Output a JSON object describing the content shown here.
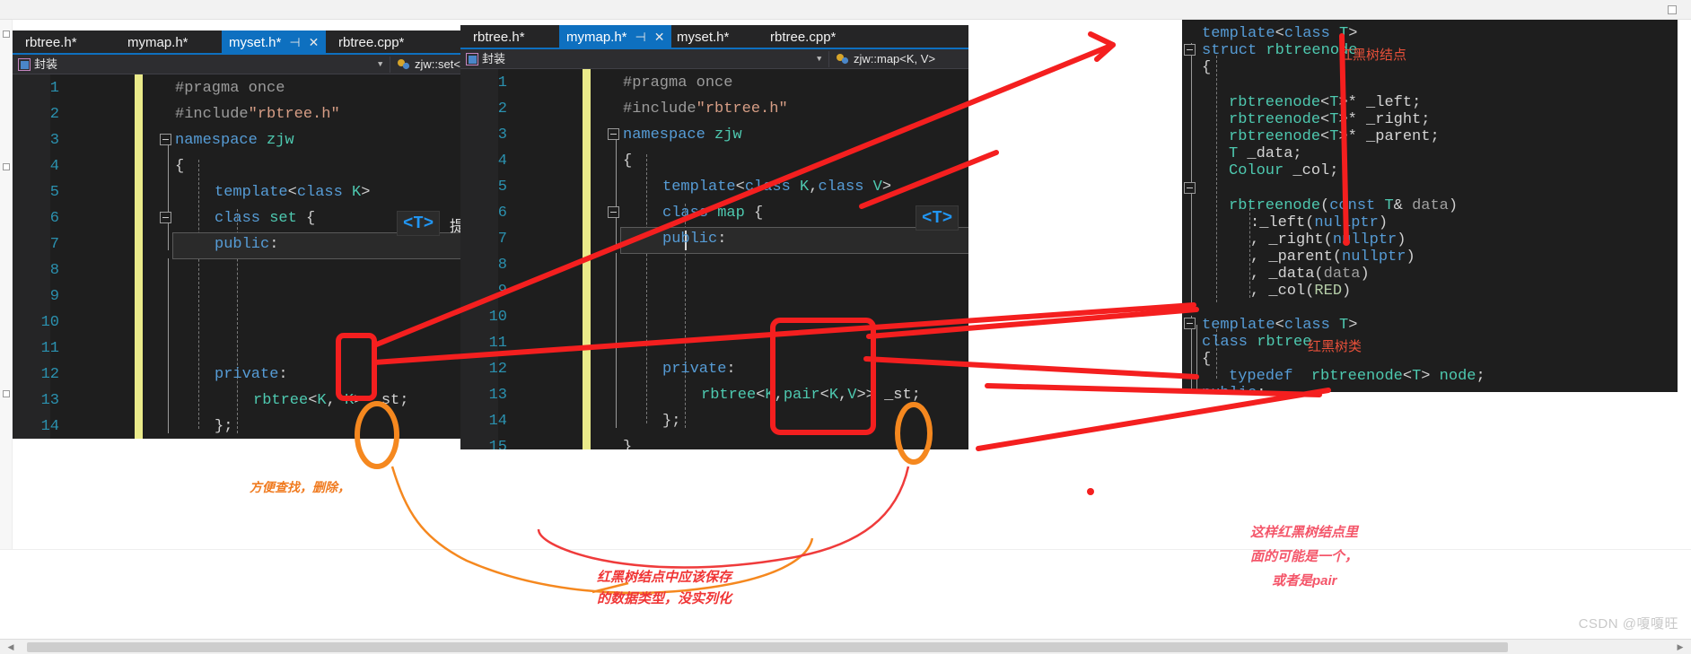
{
  "watermark": "CSDN @嗄嗄旺",
  "window_set": {
    "tabs": [
      {
        "label": "rbtree.h*",
        "active": false
      },
      {
        "label": "mymap.h*",
        "active": false
      },
      {
        "label": "myset.h*",
        "active": true
      },
      {
        "label": "rbtree.cpp*",
        "active": false
      }
    ],
    "nav": {
      "scope_label": "封装",
      "member_label": "zjw::set<K"
    },
    "badge": "<T>",
    "badge_hint": "提",
    "lines": [
      {
        "no": "1",
        "code": "#pragma once"
      },
      {
        "no": "2",
        "code": "#include\"rbtree.h\""
      },
      {
        "no": "3",
        "code": "namespace zjw"
      },
      {
        "no": "4",
        "code": "{"
      },
      {
        "no": "5",
        "code": "template<class K>"
      },
      {
        "no": "6",
        "code": "class set {"
      },
      {
        "no": "7",
        "code": "public:"
      },
      {
        "no": "8",
        "code": ""
      },
      {
        "no": "9",
        "code": ""
      },
      {
        "no": "10",
        "code": ""
      },
      {
        "no": "11",
        "code": "private:"
      },
      {
        "no": "12",
        "code": "rbtree<K, K> _st;"
      },
      {
        "no": "13",
        "code": "};"
      },
      {
        "no": "14",
        "code": "}"
      }
    ]
  },
  "window_map": {
    "tabs": [
      {
        "label": "rbtree.h*",
        "active": false
      },
      {
        "label": "mymap.h*",
        "active": true
      },
      {
        "label": "myset.h*",
        "active": false
      },
      {
        "label": "rbtree.cpp*",
        "active": false
      }
    ],
    "nav": {
      "scope_label": "封装",
      "member_label": "zjw::map<K, V>"
    },
    "badge": "<T>",
    "lines": [
      {
        "no": "1",
        "code": "#pragma once"
      },
      {
        "no": "2",
        "code": "#include\"rbtree.h\""
      },
      {
        "no": "3",
        "code": "namespace zjw"
      },
      {
        "no": "4",
        "code": "{"
      },
      {
        "no": "5",
        "code": "template<class K,class V>"
      },
      {
        "no": "6",
        "code": "class map {"
      },
      {
        "no": "7",
        "code": "public:"
      },
      {
        "no": "8",
        "code": ""
      },
      {
        "no": "9",
        "code": ""
      },
      {
        "no": "10",
        "code": ""
      },
      {
        "no": "11",
        "code": "private:"
      },
      {
        "no": "12",
        "code": "rbtree<K,pair<K,V>> _st;"
      },
      {
        "no": "13",
        "code": "};"
      },
      {
        "no": "14",
        "code": "}"
      },
      {
        "no": "15",
        "code": ""
      }
    ]
  },
  "window_rbtree": {
    "lines": [
      "template<class T>",
      "struct rbtreenode",
      "{",
      "rbtreenode<T>* _left;",
      "rbtreenode<T>* _right;",
      "rbtreenode<T>* _parent;",
      "T _data;",
      "Colour _col;",
      "",
      "rbtreenode(const T& data)",
      ":_left(nullptr)",
      ", _right(nullptr)",
      ", _parent(nullptr)",
      ", _data(data)",
      ", _col(RED)",
      "",
      "template<class T>",
      "class rbtree",
      "{",
      "typedef  rbtreenode<T> node;",
      "public:"
    ],
    "comment_node": "红黑树结点",
    "comment_class": "红黑树类"
  },
  "annotations": {
    "orange_note": "方便查找，删除，",
    "red_note_line1": "红黑树结点中应该保存",
    "red_note_line2": "的数据类型，没实列化",
    "pink_note_line1": "这样红黑树结点里",
    "pink_note_line2": "面的可能是一个，",
    "pink_note_line3": "或者是pair"
  },
  "colors": {
    "accent_tab": "#0e70c0",
    "annotation_red": "#f03535",
    "annotation_orange": "#f07b20",
    "annotation_pink": "#f4566a",
    "editor_bg": "#1e1e1e",
    "line_number": "#2b91af"
  }
}
